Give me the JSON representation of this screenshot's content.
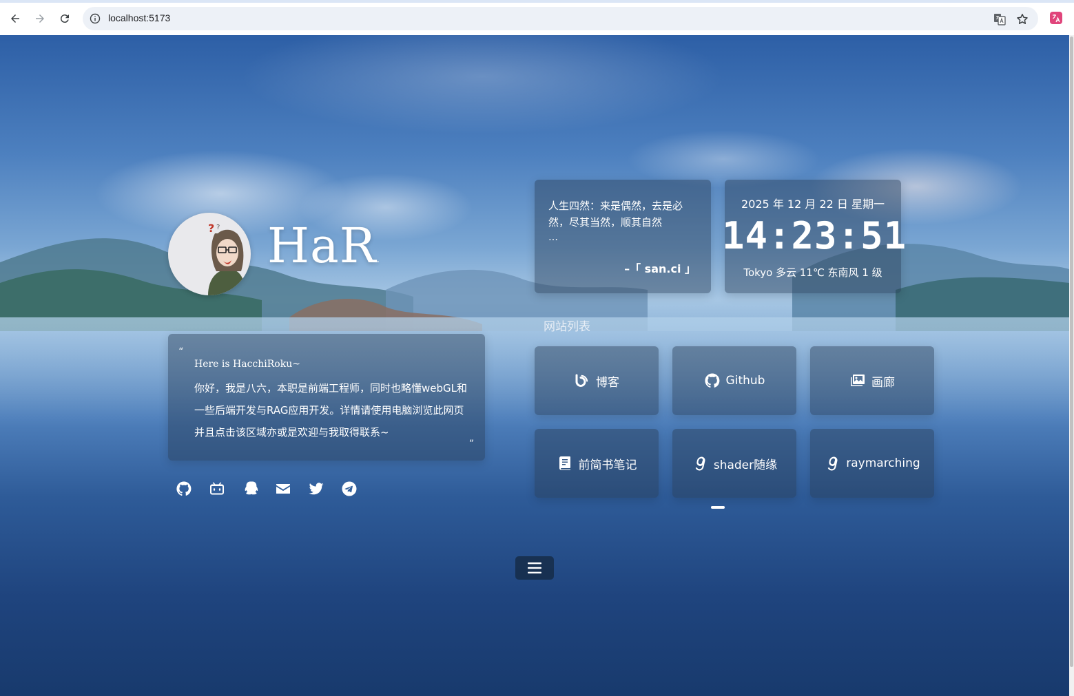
{
  "browser": {
    "url": "localhost:5173"
  },
  "profile": {
    "title": "HaR",
    "title_dot": "."
  },
  "intro": {
    "open_quote": "“",
    "close_quote": "”",
    "greeting": "Here is HacchiRoku~",
    "body": "你好，我是八六，本职是前端工程师，同时也略懂webGL和一些后端开发与RAG应用开发。详情请使用电脑浏览此网页并且点击该区域亦或是欢迎与我取得联系~"
  },
  "socials": [
    {
      "icon": "github-icon"
    },
    {
      "icon": "bilibili-icon"
    },
    {
      "icon": "qq-icon"
    },
    {
      "icon": "mail-icon"
    },
    {
      "icon": "twitter-icon"
    },
    {
      "icon": "telegram-icon"
    }
  ],
  "quote": {
    "text": "人生四然：来是偶然，去是必然，尽其当然，顺其自然",
    "ellipsis": "…",
    "author": "–「 san.ci 」"
  },
  "clock": {
    "date": "2025 年 12 月 22 日 星期一",
    "time": "14:23:51",
    "weather": "Tokyo 多云 11℃ 东南风 1 级"
  },
  "sites": {
    "title": "网站列表",
    "items": [
      {
        "label": "博客",
        "icon": "blog-icon"
      },
      {
        "label": "Github",
        "icon": "github-icon"
      },
      {
        "label": "画廊",
        "icon": "gallery-icon"
      },
      {
        "label": "前简书笔记",
        "icon": "book-icon"
      },
      {
        "label": "shader随缘",
        "icon": "glsl-icon"
      },
      {
        "label": "raymarching",
        "icon": "glsl-icon"
      }
    ]
  },
  "colors": {
    "glass": "#283c55",
    "accent": "#ffffff"
  }
}
